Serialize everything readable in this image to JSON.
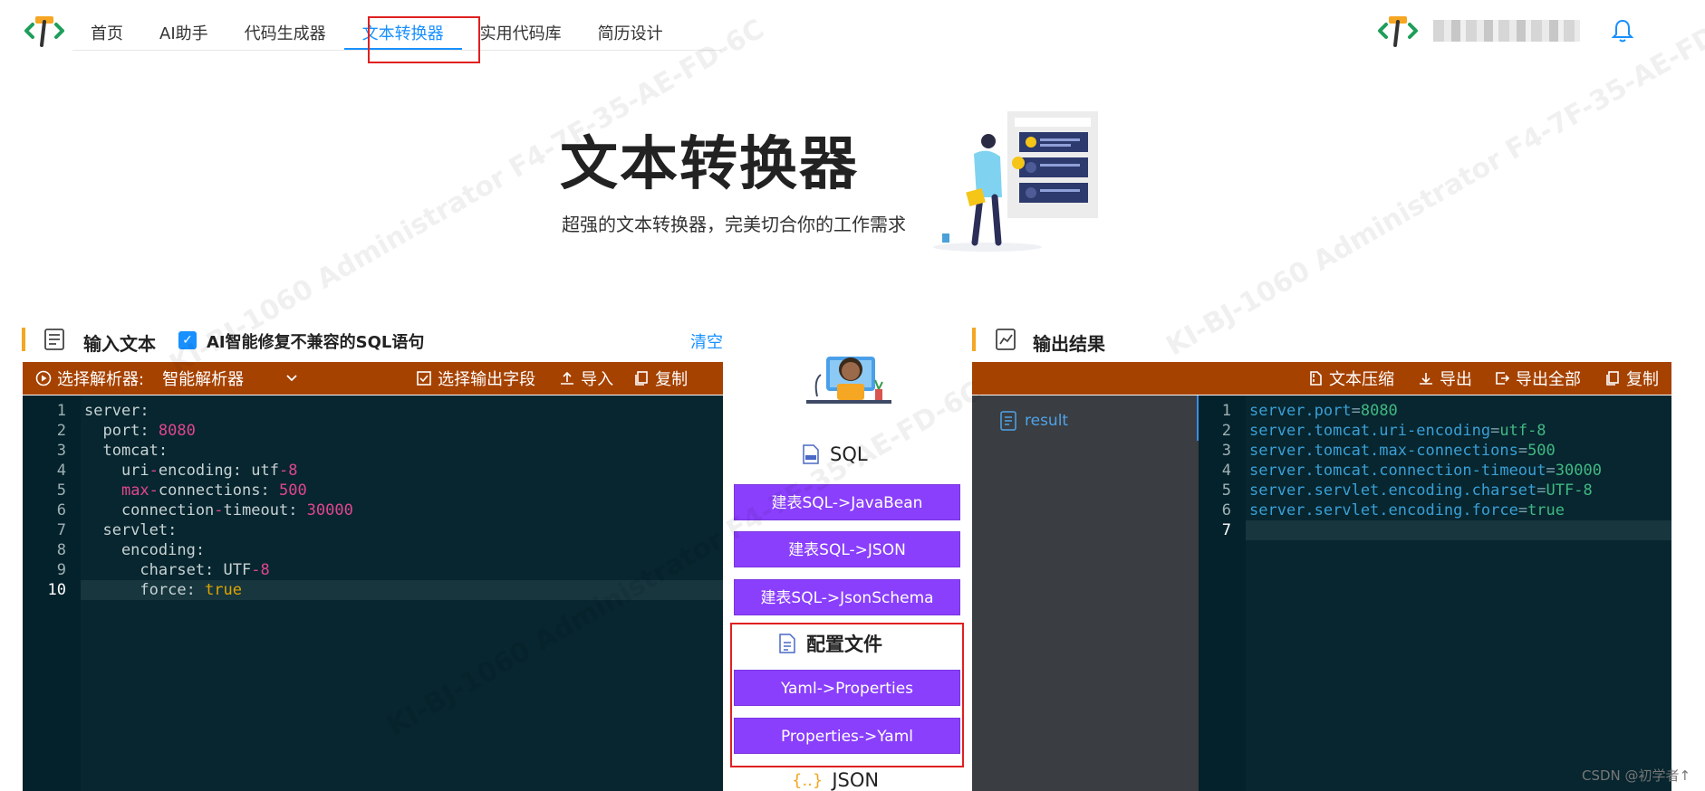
{
  "nav": {
    "items": [
      "首页",
      "AI助手",
      "代码生成器",
      "文本转换器",
      "实用代码库",
      "简历设计"
    ],
    "active": "文本转换器"
  },
  "hero": {
    "title": "文本转换器",
    "subtitle": "超强的文本转换器，完美切合你的工作需求"
  },
  "input_section": {
    "title": "输入文本",
    "ai_fix_label": "AI智能修复不兼容的SQL语句",
    "ai_fix_checked": true,
    "clear_label": "清空",
    "toolbar": {
      "parser_label": "选择解析器:",
      "parser_value": "智能解析器",
      "select_fields": "选择输出字段",
      "import": "导入",
      "copy": "复制"
    },
    "code_lines": [
      "server:",
      "  port: 8080",
      "  tomcat:",
      "    uri-encoding: utf-8",
      "    max-connections: 500",
      "    connection-timeout: 30000",
      "  servlet:",
      "    encoding:",
      "      charset: UTF-8",
      "      force: true"
    ],
    "active_line": 10
  },
  "middle": {
    "sql_heading": "SQL",
    "sql_buttons": [
      "建表SQL->JavaBean",
      "建表SQL->JSON",
      "建表SQL->JsonSchema"
    ],
    "config_heading": "配置文件",
    "config_buttons": [
      "Yaml->Properties",
      "Properties->Yaml"
    ],
    "json_heading": "JSON"
  },
  "output_section": {
    "title": "输出结果",
    "toolbar": {
      "compress": "文本压缩",
      "export": "导出",
      "export_all": "导出全部",
      "copy": "复制"
    },
    "tree_item": "result",
    "code_lines": [
      "server.port=8080",
      "server.tomcat.uri-encoding=utf-8",
      "server.tomcat.max-connections=500",
      "server.tomcat.connection-timeout=30000",
      "server.servlet.encoding.charset=UTF-8",
      "server.servlet.encoding.force=true",
      ""
    ],
    "active_line": 7
  },
  "watermark": "KI-BJ-1060 Administrator F4-7F-35-AE-FD-6C",
  "footer": "CSDN @初学者↑",
  "colors": {
    "accent": "#1890ff",
    "toolbar": "#a64200",
    "editor_bg": "#07262f",
    "purple_button": "#8a3ffc",
    "section_bar": "#f5a623",
    "highlight_box": "#e02020"
  }
}
